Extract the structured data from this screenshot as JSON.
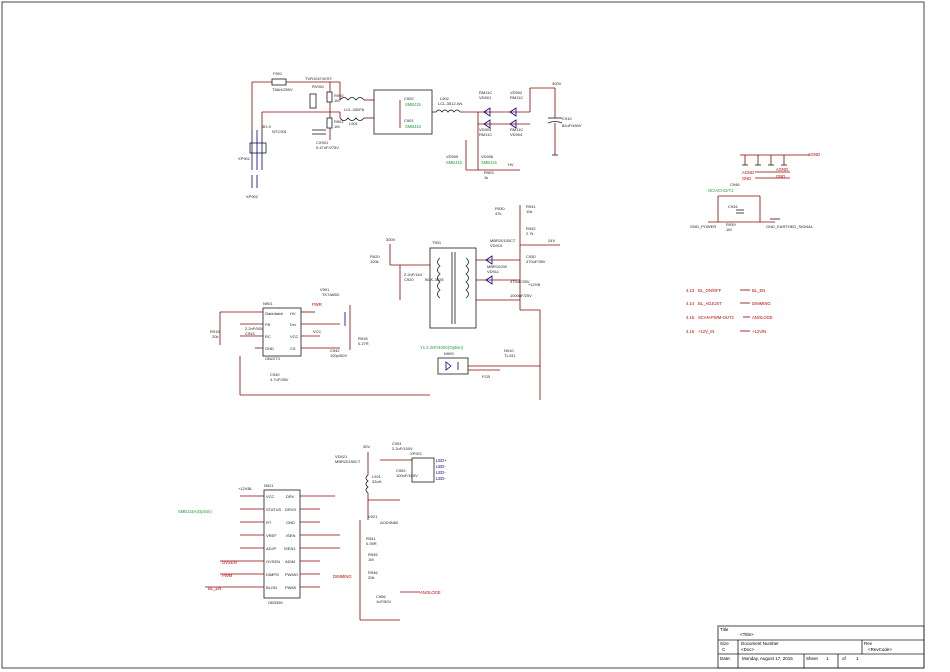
{
  "title_block": {
    "title_label": "Title",
    "title_value": "<Title>",
    "size_label": "Size",
    "size_value": "C",
    "doc_label": "Document Number",
    "doc_value": "<Doc>",
    "rev_label": "Rev",
    "rev_value": "<RevCode>",
    "date_label": "Date:",
    "date_value": "Monday, August 17, 2015",
    "sheet_label": "Sheet",
    "sheet_num": "1",
    "of_label": "of",
    "sheet_total": "1"
  },
  "power_input": {
    "fuse": "F901",
    "fuse_val": "T5AH/250V",
    "varistor": "RV901",
    "varistor_val": "TVR10471KSY",
    "cap_x1": "CX901",
    "cap_x1_val": "0.47uF/275V",
    "r1": "R902",
    "r1_val": "1M",
    "r2": "R901",
    "r2_val": "1M",
    "choke": "L901",
    "choke_val": "LCL-330F8",
    "cy": "CY901",
    "cy_val": "680p/275V",
    "ntc": "NTC901",
    "ntc_val": "5D-9",
    "conn": "XP901",
    "conn2": "XP902",
    "cap_b1": "C902",
    "cap_b2": "C901",
    "bridge": "L902",
    "bridge_val": "LCL-3512-WL",
    "d1": "VD901",
    "d1_val": "RM11C",
    "d2": "VD902",
    "d2_val": "RM11C",
    "d3": "VD903",
    "d3_val": "RM11C",
    "d4": "VD904",
    "d4_val": "RM11C",
    "bulk": "C910",
    "bulk_val": "82uF/450V",
    "net_300v": "300V",
    "vd_a": "VD905",
    "vd_b": "VD906",
    "r_hv": "R903",
    "r_hv_val": "1k",
    "hv_label": "HV",
    "green_a": "SMBJ15",
    "green_b": "SMBJ15"
  },
  "ground_block": {
    "agnd": "AGND",
    "agnd2": "AGND",
    "gnd": "GND",
    "cap": "C946",
    "cap_val": "NC/AC/X2/Y1",
    "cap2": "C934",
    "res": "R939",
    "res_val": "1M",
    "gnd_power": "GND_POWER",
    "gnd_earth": "GND_EARTHED_SIGNAL"
  },
  "flyback": {
    "ic": "N901",
    "ic_val": "OB2273",
    "ic_pins": [
      "Gate/latch",
      "FB",
      "RC",
      "GND",
      "HV",
      "Drv",
      "VCC",
      "CS"
    ],
    "pin_nums_left": [
      "1",
      "2",
      "3",
      "4"
    ],
    "pin_nums_right": [
      "8",
      "7",
      "6",
      "5"
    ],
    "trafo": "T901",
    "trafo_val": "BCK-3028",
    "mosfet": "V901",
    "mosfet_val": "TK7A65D",
    "d_out1": "VD910",
    "d_out1_val": "MBR20100CT",
    "d_out2": "VD911",
    "d_out2_val": "MBR10200",
    "cap_out1": "C930",
    "cap_out1_val": "470uF/35V",
    "cap_out2": "C931",
    "cap_out2_val": "470uF/25V",
    "cap_out3": "C932",
    "cap_out3_val": "1000uF/25V",
    "opto": "N909",
    "opto_val": "PC817",
    "ref": "N910",
    "ref_val": "TL431",
    "net_pwr": "PWR",
    "net_vcc": "VCC",
    "net_12v": "+12VB",
    "net_24v": "24V",
    "net_fb": "FCB",
    "net_300v": "300V",
    "r_sense": "R918",
    "r_sense_val": "0.27R",
    "cs_cap": "C942",
    "cs_cap_val": "100p/50V",
    "vcc_cap": "C940",
    "vcc_cap_val": "4.7uF/35V",
    "rc_res": "R915",
    "rc_res_val": "20k",
    "fb_cap": "C943",
    "fb_cap_val": "2.2nF/50V",
    "snub_cap": "C920",
    "snub_cap_val": "2.2nF/1kV",
    "snub_res": "R920",
    "snub_res_val": "100k",
    "green_note": "Y1:2.2nF/400V(Option)",
    "fb_res1": "R930",
    "fb_res1_val": "47k",
    "fb_res2": "R931",
    "fb_res2_val": "10k",
    "fb_res3": "R932",
    "fb_res3_val": "2.7k"
  },
  "io_labels": [
    {
      "pin": "4.13",
      "name": "BL_ON/OFF",
      "net": "BL_EN"
    },
    {
      "pin": "4.14",
      "name": "BL_ADJUST",
      "net": "DIMMING"
    },
    {
      "pin": "4.15",
      "name": "SCAN-PWM-OUT2",
      "net": "ANOLOGE"
    },
    {
      "pin": "4.16",
      "name": "+12V_IN",
      "net": "+12VIN"
    }
  ],
  "led_driver": {
    "ic": "N921",
    "ic_val": "OB3350",
    "pins_left": [
      "VCC",
      "STATUS",
      "RT",
      "VREF",
      "ADJP",
      "OVSEN",
      "DIMPG",
      "BLON"
    ],
    "pins_right": [
      "DRV",
      "DRVS",
      "GND",
      "ISEN",
      "ISEN1",
      "ADIM",
      "PWMO",
      "PWMI"
    ],
    "nums_left": [
      "16",
      "15",
      "14",
      "13",
      "12",
      "11",
      "10",
      "9"
    ],
    "nums_right": [
      "1",
      "2",
      "3",
      "4",
      "5",
      "6",
      "7",
      "8"
    ],
    "net_12v": "+12VBL",
    "net_ovsen": "OVSEN",
    "net_pwm": "PWM",
    "net_blen": "BL_EN",
    "net_dimming": "DIMMING",
    "net_anologe": "ANOLOGE",
    "inductor": "L921",
    "inductor_val": "33uH",
    "mosfet": "V921",
    "mosfet_val": "AOD4N60",
    "diode": "VD921",
    "diode_val": "MBR20150CT",
    "cap_out": "C951",
    "cap_out_val": "2.2uF/100V",
    "cap_out2": "C952",
    "cap_out2_val": "100uF/100V",
    "conn": "XP921",
    "net_30v": "30V",
    "led_pins": [
      "LED+",
      "LED-",
      "LED-",
      "LED-"
    ],
    "green_note": "SMBJ15A(Option)",
    "r_isen": "R941",
    "r_isen_val": "0.39R",
    "r_ovp": "R945",
    "r_ovp_val": "1M",
    "r_ovp2": "R946",
    "r_ovp2_val": "20k",
    "c_comp": "C956",
    "c_comp_val": "1uF/50V"
  }
}
